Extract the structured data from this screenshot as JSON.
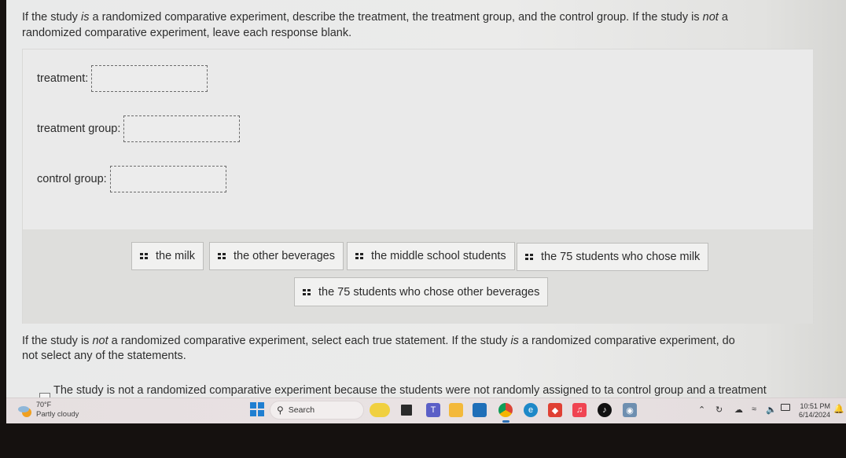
{
  "instructions": {
    "part1": "If the study ",
    "is": "is",
    "part2": " a randomized comparative experiment, describe the treatment, the treatment group, and the control group. If the study is ",
    "not": "not",
    "part3": " a randomized comparative experiment, leave each response blank."
  },
  "fields": [
    {
      "label": "treatment:",
      "value": ""
    },
    {
      "label": "treatment group:",
      "value": ""
    },
    {
      "label": "control group:",
      "value": ""
    }
  ],
  "answer_bank": [
    "the milk",
    "the other beverages",
    "the middle school students",
    "the 75 students who chose milk",
    "the 75 students who chose other beverages"
  ],
  "question2": {
    "part1": "If the study is ",
    "not": "not",
    "part2": " a randomized comparative experiment, select each true statement. If the study ",
    "is": "is",
    "part3": " a randomized comparative experiment, do not select any of the statements."
  },
  "statements": [
    {
      "text": "The study is not a randomized comparative experiment because the students were not randomly assigned to ta control group and a treatment",
      "checked": false
    }
  ],
  "taskbar": {
    "weather_temp": "70°F",
    "weather_condition": "Partly cloudy",
    "search_label": "Search",
    "time": "10:51 PM",
    "date": "6/14/2024",
    "apps": [
      "widgets-lemon",
      "terminal",
      "teams",
      "file-explorer",
      "microsoft-store",
      "chrome",
      "edge",
      "anydesk",
      "apple-music",
      "tiktok",
      "camera"
    ],
    "accent_color": "#1f7fd1"
  }
}
